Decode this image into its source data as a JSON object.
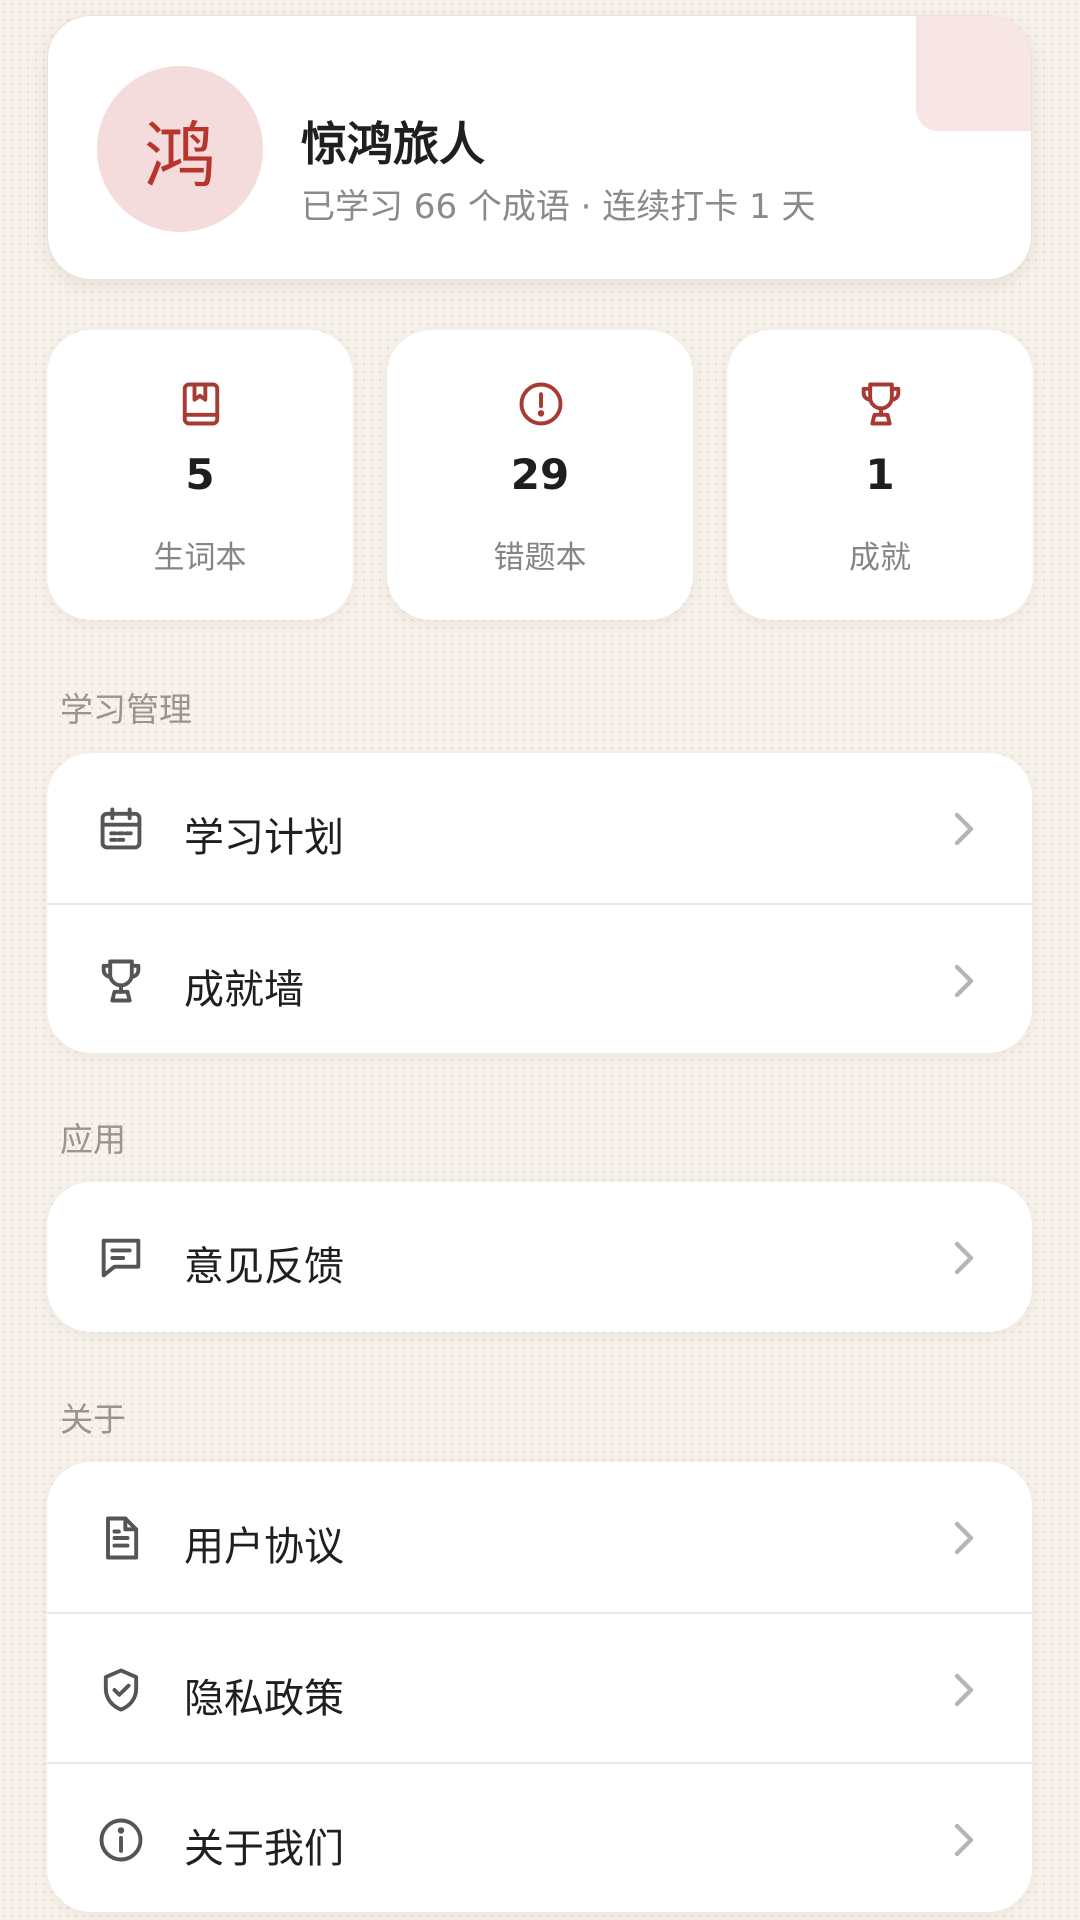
{
  "profile": {
    "avatar_char": "鸿",
    "name": "惊鸿旅人",
    "stats_line": "已学习 66 个成语 · 连续打卡 1 天"
  },
  "stats": [
    {
      "icon": "bookmark-book-icon",
      "value": "5",
      "label": "生词本"
    },
    {
      "icon": "alert-circle-icon",
      "value": "29",
      "label": "错题本"
    },
    {
      "icon": "trophy-icon",
      "value": "1",
      "label": "成就"
    }
  ],
  "sections": {
    "learning": {
      "title": "学习管理",
      "items": [
        {
          "icon": "calendar-icon",
          "label": "学习计划"
        },
        {
          "icon": "trophy-icon",
          "label": "成就墙"
        }
      ]
    },
    "app": {
      "title": "应用",
      "items": [
        {
          "icon": "message-icon",
          "label": "意见反馈"
        }
      ]
    },
    "about": {
      "title": "关于",
      "items": [
        {
          "icon": "document-icon",
          "label": "用户协议"
        },
        {
          "icon": "shield-check-icon",
          "label": "隐私政策"
        },
        {
          "icon": "info-icon",
          "label": "关于我们"
        }
      ]
    }
  },
  "colors": {
    "accent": "#a83a34",
    "icon_gray": "#555555",
    "background": "#f6f1ea",
    "avatar_bg": "#f3dcdb"
  }
}
